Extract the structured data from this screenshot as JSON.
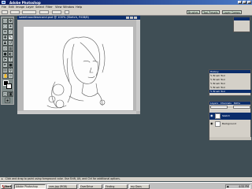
{
  "app": {
    "title": "Adobe Photoshop",
    "controls": [
      "_",
      "□",
      "x"
    ]
  },
  "menu": [
    "File",
    "Edit",
    "Image",
    "Layer",
    "Select",
    "Filter",
    "View",
    "Window",
    "Help"
  ],
  "options": {
    "tabs": [
      "Brushes",
      "Tool Presets",
      "Layer Comps"
    ]
  },
  "document": {
    "title": "sweetnoodlesecond.psd @ 100% (Sketch, RGB/8)"
  },
  "history_panel": {
    "title": "History",
    "items": [
      "Brush Tool",
      "Brush Tool",
      "Brush Tool",
      "Brush Tool",
      "Brush Tool"
    ]
  },
  "layers_panel": {
    "title": "Layers",
    "tabs": [
      "Channels",
      "Paths"
    ],
    "layers": [
      "Sketch",
      "Background"
    ]
  },
  "status": {
    "text": "Click and drag to paint using foreground color. Use Shift, Alt, and Ctrl for additional options."
  },
  "taskbar": {
    "start": "Start",
    "tasks": [
      "Adobe Photoshop",
      "cars.jpg (RGB)",
      "OverDrive",
      "Finding",
      "my Docs"
    ],
    "clock": "4:55 PM"
  },
  "colors": {
    "workspace": "#3f4e55",
    "titlebar": "#0b2d6b",
    "panel": "#d4d0c8"
  }
}
